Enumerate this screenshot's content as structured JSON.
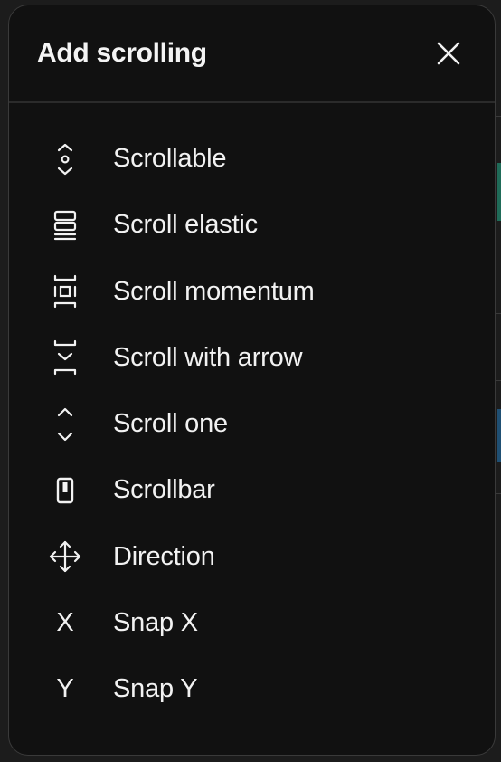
{
  "dialog": {
    "title": "Add scrolling",
    "close_icon": "close-icon"
  },
  "menu": {
    "items": [
      {
        "label": "Scrollable",
        "icon": "scrollable-icon"
      },
      {
        "label": "Scroll elastic",
        "icon": "scroll-elastic-icon"
      },
      {
        "label": "Scroll momentum",
        "icon": "scroll-momentum-icon"
      },
      {
        "label": "Scroll with arrow",
        "icon": "scroll-with-arrow-icon"
      },
      {
        "label": "Scroll one",
        "icon": "scroll-one-icon"
      },
      {
        "label": "Scrollbar",
        "icon": "scrollbar-icon"
      },
      {
        "label": "Direction",
        "icon": "direction-icon"
      },
      {
        "label": "Snap X",
        "icon": "snap-x-icon",
        "glyph": "X"
      },
      {
        "label": "Snap Y",
        "icon": "snap-y-icon",
        "glyph": "Y"
      }
    ]
  },
  "colors": {
    "panel_bg": "#111111",
    "text": "#f2f2f2",
    "border": "#3a3a3a"
  }
}
